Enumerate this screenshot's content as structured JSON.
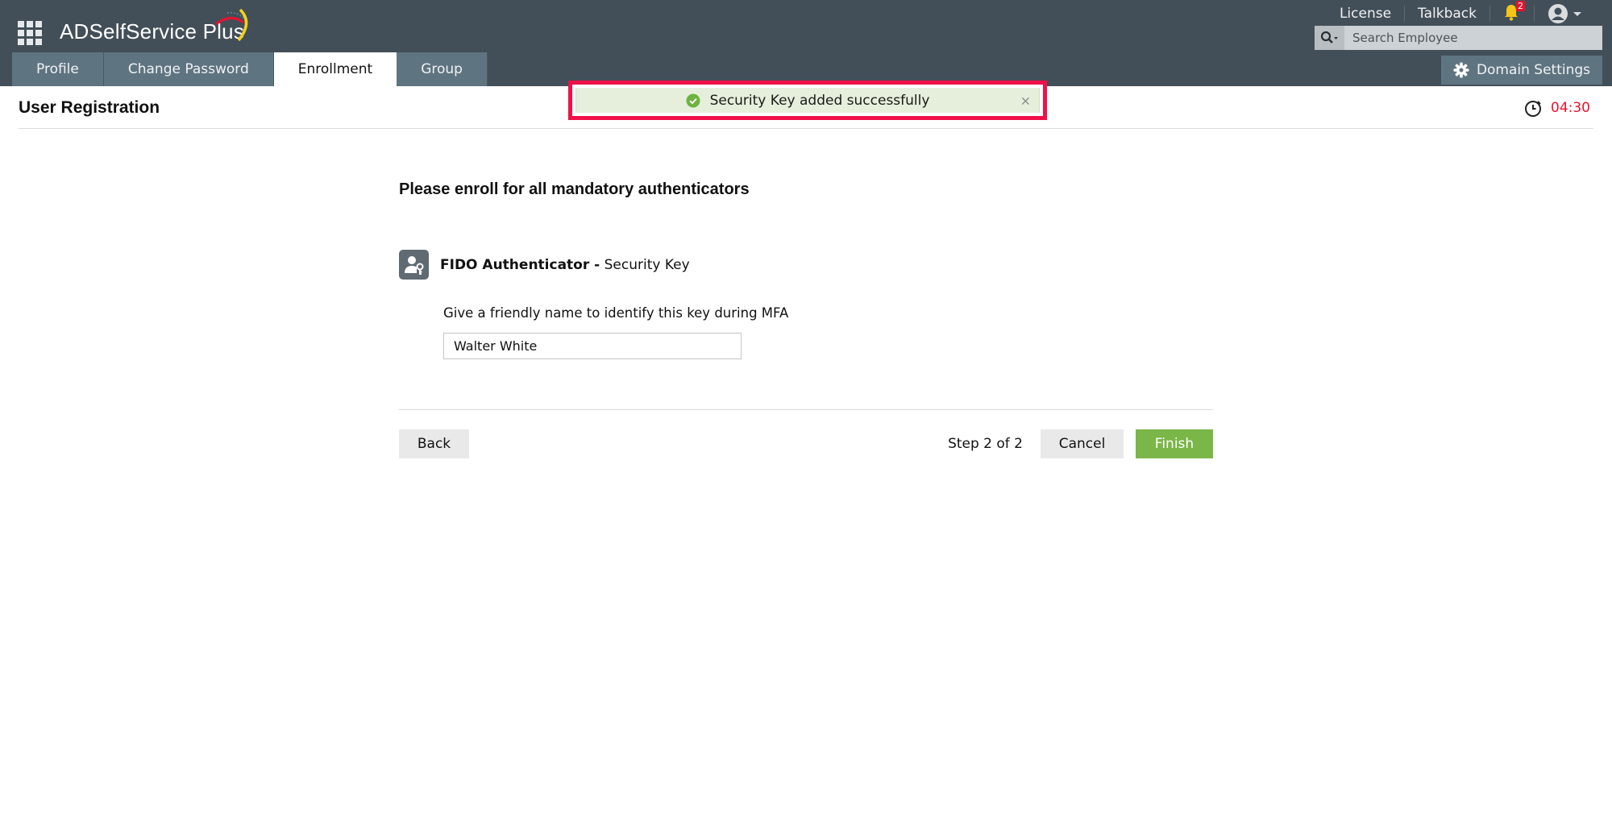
{
  "app": {
    "name": "ADSelfService Plus",
    "icons": {
      "apps": "grid-apps-icon",
      "logo": "swoosh-logo-icon"
    }
  },
  "header": {
    "links": [
      {
        "label": "License"
      },
      {
        "label": "Talkback"
      }
    ],
    "notifications": {
      "icon": "bell-icon",
      "count": "2"
    },
    "user_menu": {
      "icon": "user-avatar-icon",
      "caret": "caret-down-icon"
    },
    "search": {
      "placeholder": "Search Employee",
      "value": "",
      "icon": "search-icon"
    }
  },
  "tabs": [
    {
      "label": "Profile",
      "active": false
    },
    {
      "label": "Change Password",
      "active": false
    },
    {
      "label": "Enrollment",
      "active": true
    },
    {
      "label": "Group",
      "active": false
    }
  ],
  "domain_settings": {
    "label": "Domain Settings",
    "icon": "gear-icon"
  },
  "toast": {
    "message": "Security Key added successfully",
    "icon": "check-circle-icon",
    "close_label": "×",
    "highlight_color": "#f0104a",
    "background": "#e6efdb"
  },
  "page": {
    "title": "User Registration",
    "timer": {
      "value": "04:30",
      "icon": "stopwatch-icon",
      "color": "#e8122e"
    }
  },
  "enrollment": {
    "heading": "Please enroll for all mandatory authenticators",
    "authenticator": {
      "name_bold": "FIDO Authenticator -",
      "name_rest": " Security Key",
      "icon": "user-key-icon"
    },
    "field_label": "Give a friendly name to identify this key during MFA",
    "field_value": "Walter White",
    "footer": {
      "back_label": "Back",
      "step_text": "Step 2 of 2",
      "cancel_label": "Cancel",
      "finish_label": "Finish",
      "finish_color": "#7ab648"
    }
  }
}
